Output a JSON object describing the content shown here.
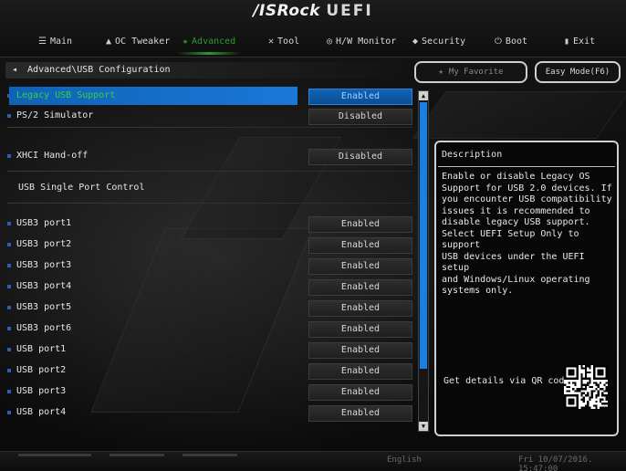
{
  "header": {
    "logo_brand": "/ISRock",
    "logo_suffix": "UEFI"
  },
  "tabs": [
    {
      "label": "Main",
      "icon": "list-icon",
      "icon_glyph": "☰"
    },
    {
      "label": "OC Tweaker",
      "icon": "rocket-icon",
      "icon_glyph": "▲"
    },
    {
      "label": "Advanced",
      "icon": "star-icon",
      "icon_glyph": "★"
    },
    {
      "label": "Tool",
      "icon": "wrench-icon",
      "icon_glyph": "✕"
    },
    {
      "label": "H/W Monitor",
      "icon": "gauge-icon",
      "icon_glyph": "◎"
    },
    {
      "label": "Security",
      "icon": "shield-icon",
      "icon_glyph": "◆"
    },
    {
      "label": "Boot",
      "icon": "power-icon",
      "icon_glyph": "⏻"
    },
    {
      "label": "Exit",
      "icon": "door-icon",
      "icon_glyph": "▮"
    }
  ],
  "active_tab": "Advanced",
  "breadcrumb": {
    "back_glyph": "◂",
    "text": "Advanced\\USB Configuration"
  },
  "favorite_button": {
    "label": "My Favorite",
    "star_glyph": "★"
  },
  "easy_mode_button": {
    "label": "Easy Mode(F6)"
  },
  "settings": [
    {
      "label": "Legacy USB Support",
      "value": "Enabled",
      "selected": true
    },
    {
      "label": "PS/2 Simulator",
      "value": "Disabled"
    },
    {
      "label": "XHCI Hand-off",
      "value": "Disabled"
    },
    {
      "label": "USB Single Port Control",
      "value": null
    },
    {
      "label": "USB3 port1",
      "value": "Enabled"
    },
    {
      "label": "USB3 port2",
      "value": "Enabled"
    },
    {
      "label": "USB3 port3",
      "value": "Enabled"
    },
    {
      "label": "USB3 port4",
      "value": "Enabled"
    },
    {
      "label": "USB3 port5",
      "value": "Enabled"
    },
    {
      "label": "USB3 port6",
      "value": "Enabled"
    },
    {
      "label": "USB port1",
      "value": "Enabled"
    },
    {
      "label": "USB port2",
      "value": "Enabled"
    },
    {
      "label": "USB port3",
      "value": "Enabled"
    },
    {
      "label": "USB port4",
      "value": "Enabled"
    }
  ],
  "description": {
    "title": "Description",
    "text": "Enable or disable Legacy OS\nSupport for USB 2.0 devices. If\nyou encounter USB compatibility\nissues it is recommended to\ndisable legacy USB support.\nSelect UEFI Setup Only to support\nUSB devices under the UEFI setup\nand Windows/Linux operating\nsystems only.",
    "qr_label": "Get details via QR code"
  },
  "footer": {
    "language": "English",
    "datetime": "Fri 10/07/2016. 15:47:00"
  },
  "colors": {
    "accent_green": "#2f9a2f",
    "selection_blue": "#1a78d8",
    "scrollbar_blue": "#1b7fe2"
  }
}
